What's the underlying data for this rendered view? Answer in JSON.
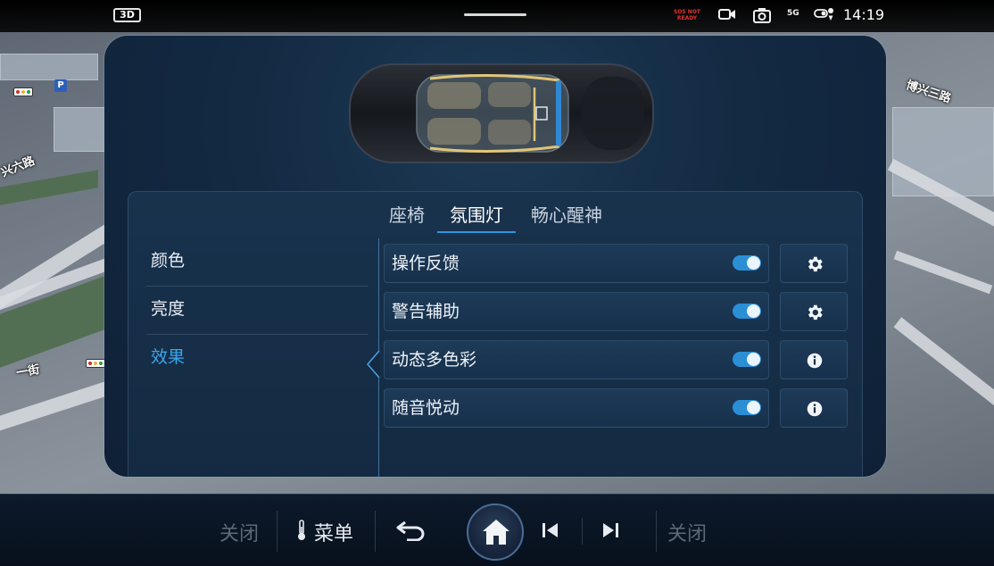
{
  "status_bar": {
    "mode_badge": "3D",
    "sos_line1": "SOS NOT",
    "sos_line2": "READY",
    "network": "5G",
    "time": "14:19",
    "icons": [
      "video-camera-icon",
      "camera-icon",
      "signal-5g-icon",
      "location-toggle-icon"
    ]
  },
  "map": {
    "labels": [
      "博兴三路",
      "兴六路",
      "一街"
    ]
  },
  "tabs": [
    {
      "label": "座椅",
      "active": false
    },
    {
      "label": "氛围灯",
      "active": true
    },
    {
      "label": "畅心醒神",
      "active": false
    }
  ],
  "sidebar": {
    "items": [
      {
        "label": "颜色",
        "active": false
      },
      {
        "label": "亮度",
        "active": false
      },
      {
        "label": "效果",
        "active": true
      }
    ]
  },
  "settings": [
    {
      "label": "操作反馈",
      "enabled": true,
      "action_icon": "gear-icon"
    },
    {
      "label": "警告辅助",
      "enabled": true,
      "action_icon": "gear-icon"
    },
    {
      "label": "动态多色彩",
      "enabled": true,
      "action_icon": "info-icon"
    },
    {
      "label": "随音悦动",
      "enabled": true,
      "action_icon": "info-icon"
    }
  ],
  "dock": {
    "left_close": "关闭",
    "menu": "菜单",
    "right_close": "关闭",
    "icons": [
      "thermometer-icon",
      "back-icon",
      "home-icon",
      "previous-track-icon",
      "next-track-icon"
    ]
  },
  "colors": {
    "accent": "#2d97dd",
    "active_text": "#3aa6ef",
    "panel_bg": "#132a43"
  }
}
